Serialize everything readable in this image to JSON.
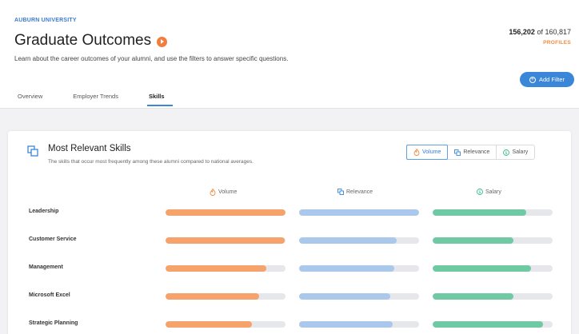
{
  "header": {
    "university": "AUBURN UNIVERSITY",
    "title": "Graduate Outcomes",
    "subtitle": "Learn about the career outcomes of your alumni, and use the filters to answer specific questions.",
    "profiles_count": "156,202",
    "profiles_of": "of 160,817",
    "profiles_label": "PROFILES",
    "add_filter_label": "Add Filter"
  },
  "tabs": [
    {
      "label": "Overview",
      "active": false
    },
    {
      "label": "Employer Trends",
      "active": false
    },
    {
      "label": "Skills",
      "active": true
    }
  ],
  "card": {
    "title": "Most Relevant Skills",
    "subtitle": "The skills that occur most frequently among these alumni compared to national averages.",
    "toggles": [
      {
        "label": "Volume",
        "icon": "flame-icon",
        "active": true
      },
      {
        "label": "Relevance",
        "icon": "relevance-icon",
        "active": false
      },
      {
        "label": "Salary",
        "icon": "dollar-icon",
        "active": false
      }
    ],
    "columns": {
      "volume": "Volume",
      "relevance": "Relevance",
      "salary": "Salary"
    }
  },
  "colors": {
    "volume": "#f5a26b",
    "relevance": "#a9c8ec",
    "salary": "#6fcaa3",
    "accent": "#3a86d8",
    "orange": "#f08a3e"
  },
  "skills": [
    {
      "name": "Leadership",
      "volume": 1.0,
      "relevance": 1.0,
      "salary": 0.78
    },
    {
      "name": "Customer Service",
      "volume": 0.99,
      "relevance": 0.81,
      "salary": 0.67
    },
    {
      "name": "Management",
      "volume": 0.84,
      "relevance": 0.79,
      "salary": 0.82
    },
    {
      "name": "Microsoft Excel",
      "volume": 0.78,
      "relevance": 0.76,
      "salary": 0.67
    },
    {
      "name": "Strategic Planning",
      "volume": 0.72,
      "relevance": 0.78,
      "salary": 0.92
    }
  ]
}
